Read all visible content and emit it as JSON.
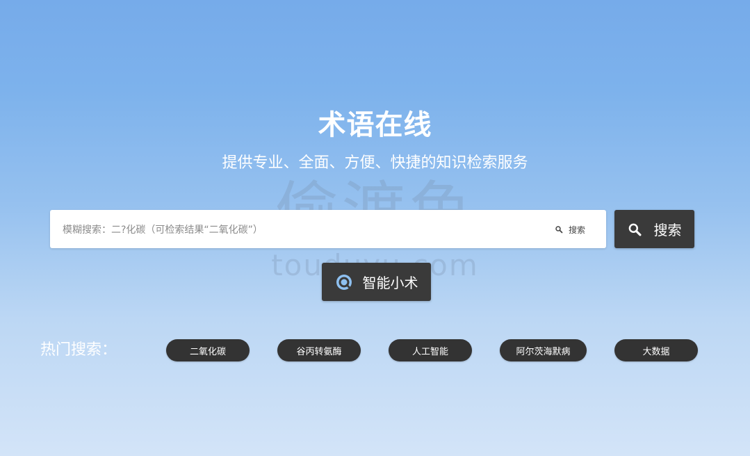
{
  "header": {
    "title": "术语在线",
    "subtitle": "提供专业、全面、方便、快捷的知识检索服务"
  },
  "watermark": {
    "text": "偷渡鱼",
    "url_text": "touduyu.com"
  },
  "search": {
    "placeholder": "模糊搜索：二?化碳（可检索结果“二氧化碳”）",
    "value": "",
    "inline_label": "搜索",
    "button_label": "搜索",
    "search_icon": "search-icon"
  },
  "ai_button": {
    "label": "智能小术",
    "icon": "assistant-icon",
    "icon_color": "#8ec0f0"
  },
  "hot_search": {
    "label": "热门搜索：",
    "tags": [
      "二氧化碳",
      "谷丙转氨酶",
      "人工智能",
      "阿尔茨海默病",
      "大数据"
    ]
  },
  "colors": {
    "accent_dark": "#3a3a3a",
    "background_top": "#76abea",
    "background_bottom": "#d3e4f8"
  }
}
